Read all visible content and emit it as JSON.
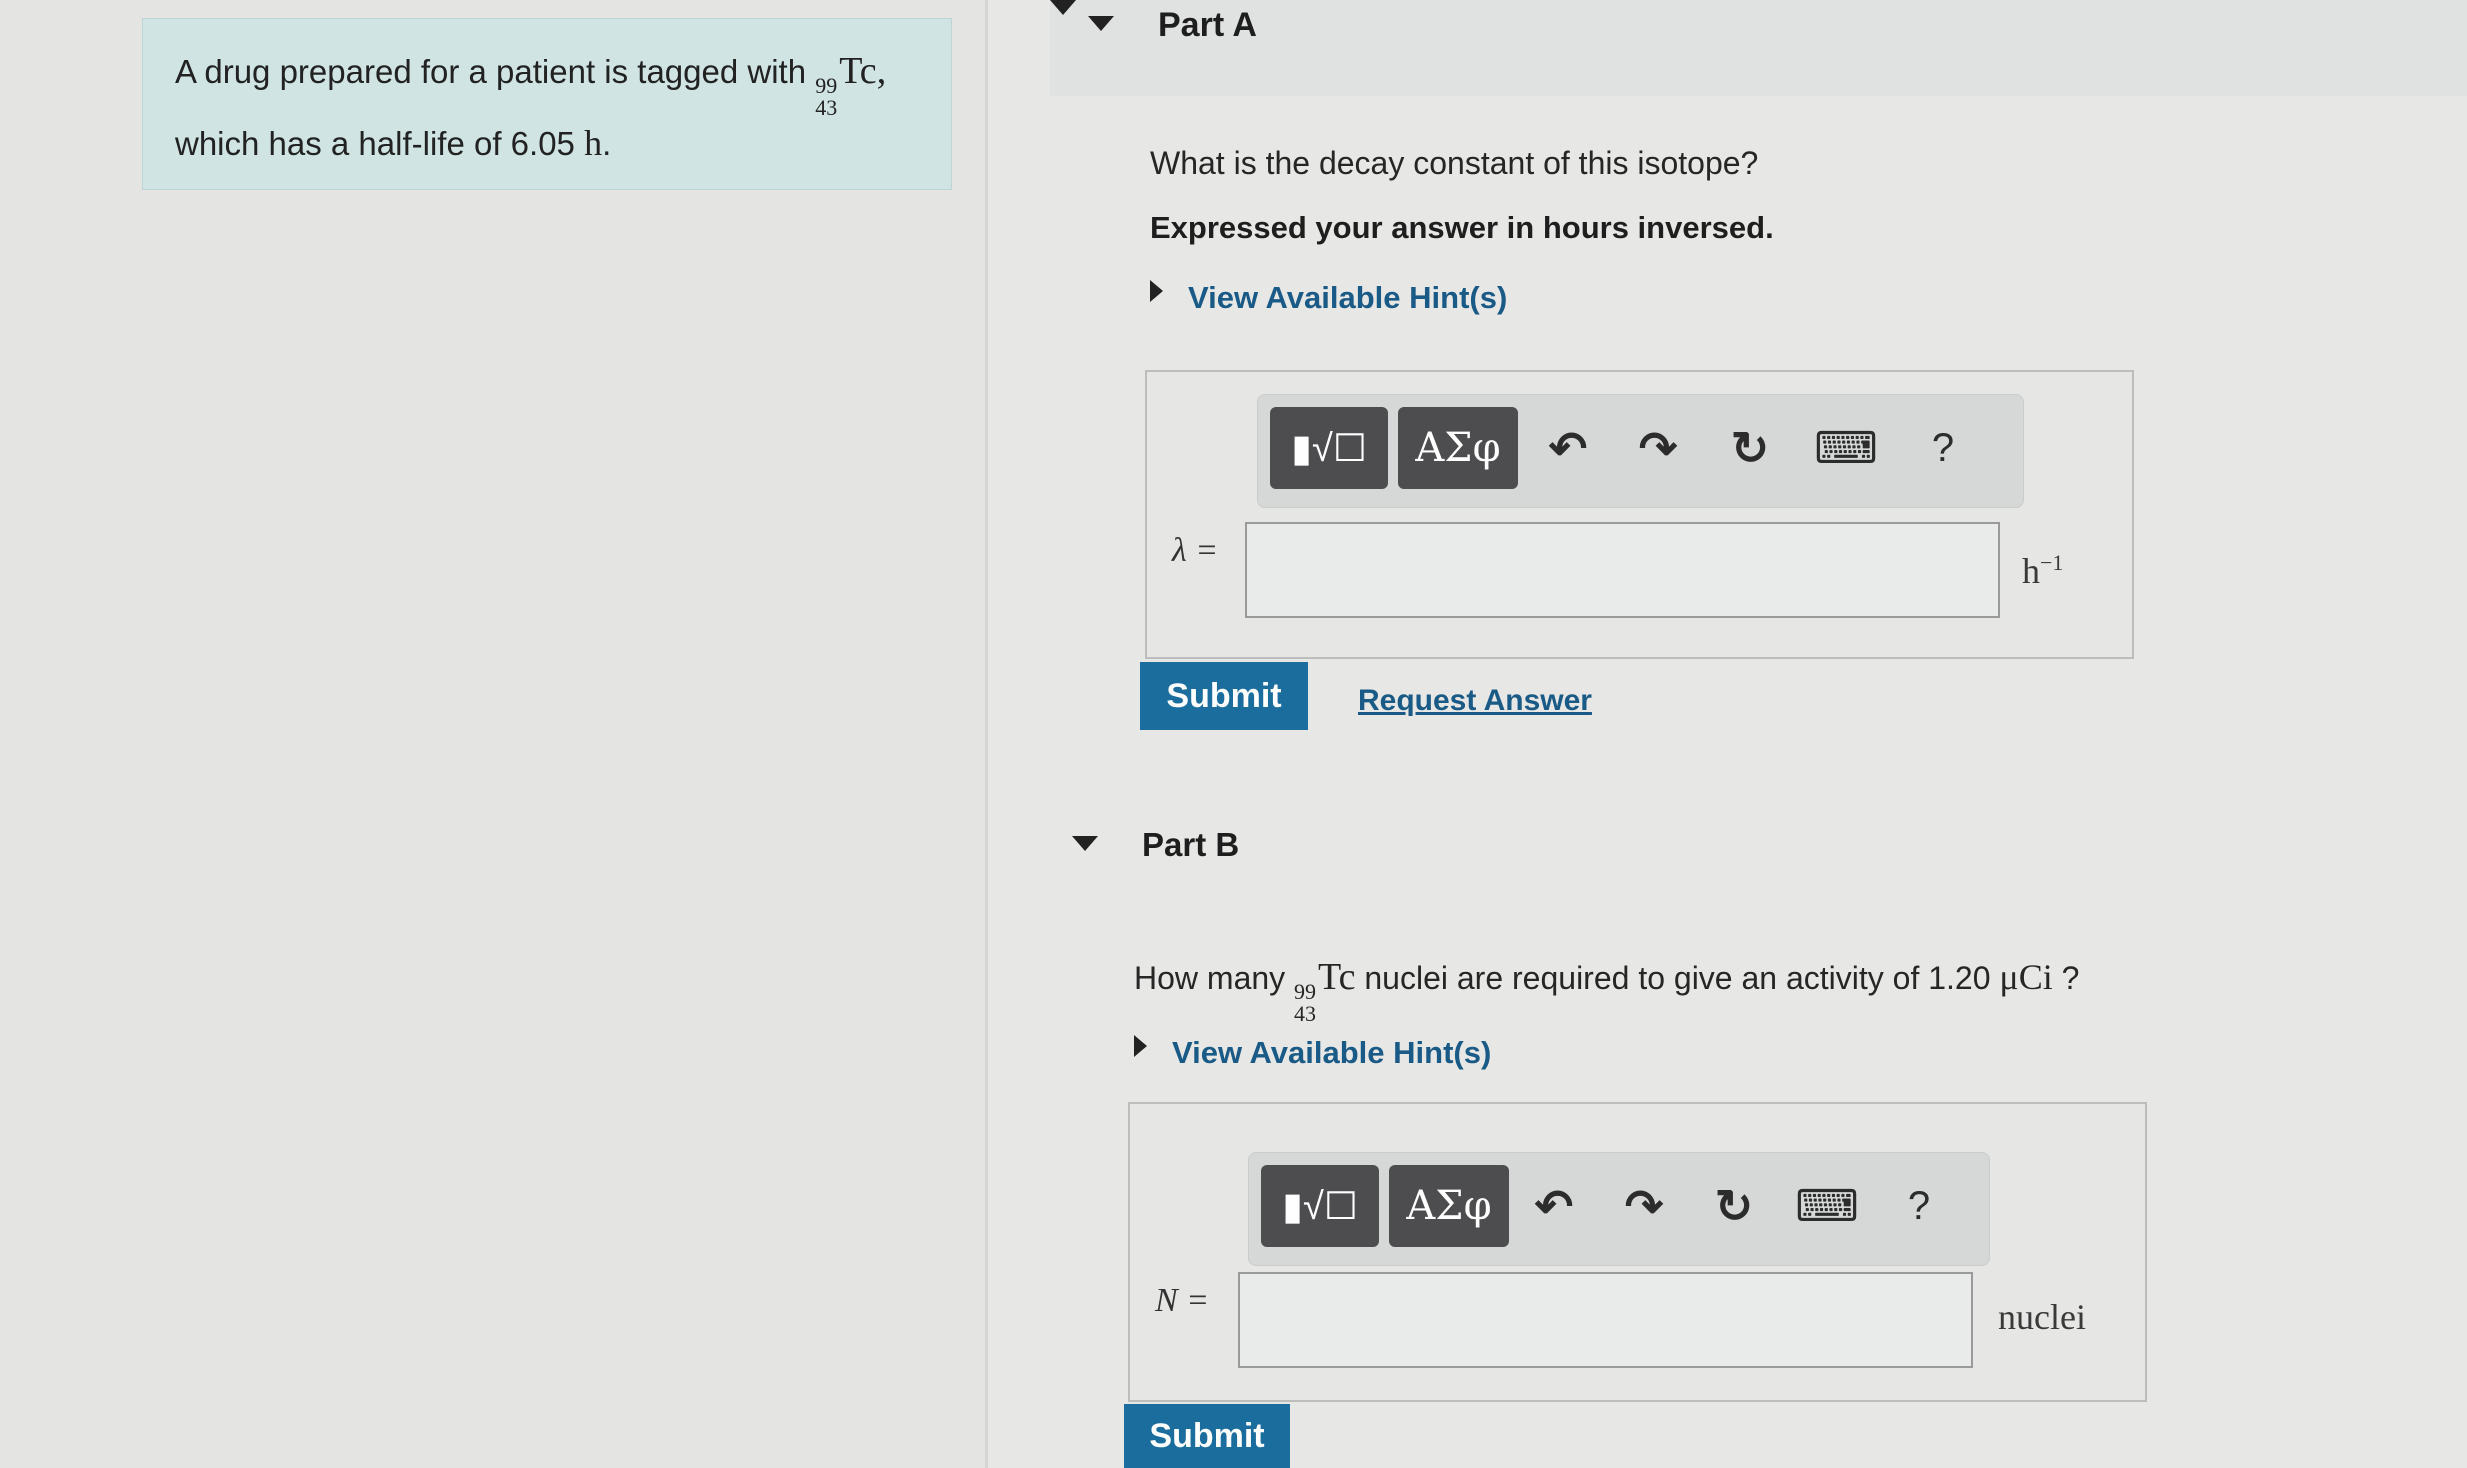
{
  "intro": {
    "text_before": "A drug prepared for a patient is tagged with ",
    "mass_number": "99",
    "atomic_number": "43",
    "symbol": "Tc",
    "text_after_symbol": ",",
    "line2_prefix": "which has a half-life of 6.05 ",
    "line2_unit": "h",
    "line2_end": "."
  },
  "part_a": {
    "title": "Part A",
    "question": "What is the decay constant of this isotope?",
    "instruction": "Expressed your answer in hours inversed.",
    "hint_label": "View Available Hint(s)",
    "toolbar": {
      "templates_label": "▮√☐",
      "greek_label": "ΑΣφ",
      "undo": "↶",
      "redo": "↷",
      "reset": "↻",
      "keyboard": "⌨",
      "help": "?"
    },
    "variable": "λ =",
    "input_value": "",
    "unit_base": "h",
    "unit_exp": "−1",
    "submit_label": "Submit",
    "request_answer_label": "Request Answer"
  },
  "part_b": {
    "title": "Part B",
    "question_prefix": "How many ",
    "mass_number": "99",
    "atomic_number": "43",
    "symbol": "Tc",
    "question_mid": " nuclei are required to give an activity of 1.20 ",
    "question_unit": "μCi",
    "question_end": " ?",
    "hint_label": "View Available Hint(s)",
    "toolbar": {
      "templates_label": "▮√☐",
      "greek_label": "ΑΣφ",
      "undo": "↶",
      "redo": "↷",
      "reset": "↻",
      "keyboard": "⌨",
      "help": "?"
    },
    "variable": "N =",
    "input_value": "",
    "unit": "nuclei",
    "submit_label": "Submit"
  }
}
